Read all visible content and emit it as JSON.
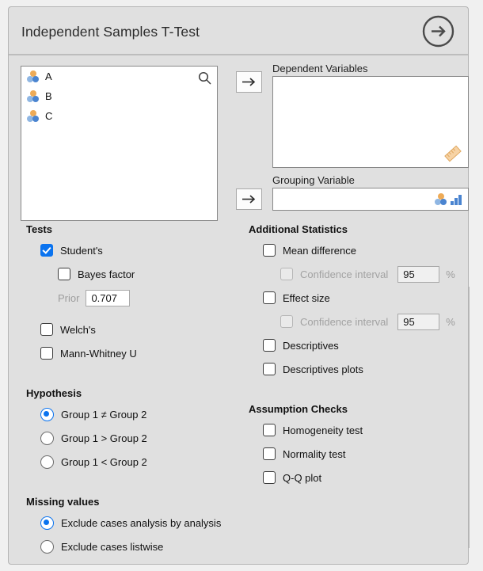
{
  "header": {
    "title": "Independent Samples T-Test",
    "next_icon": "arrow-right-circle-icon"
  },
  "variables": {
    "search_icon": "search-icon",
    "items": [
      {
        "name": "A",
        "icon": "nominal-icon"
      },
      {
        "name": "B",
        "icon": "nominal-icon"
      },
      {
        "name": "C",
        "icon": "nominal-icon"
      }
    ]
  },
  "assign_buttons": {
    "dependent_arrow": "arrow-right-icon",
    "grouping_arrow": "arrow-right-icon"
  },
  "dependent_variables": {
    "label": "Dependent Variables",
    "value": "",
    "allowed_type_icon": "scale-ruler-icon"
  },
  "grouping_variable": {
    "label": "Grouping Variable",
    "value": "",
    "allowed_type_icons": [
      "nominal-icon",
      "ordinal-icon"
    ]
  },
  "tests": {
    "title": "Tests",
    "students": {
      "label": "Student's",
      "checked": true
    },
    "bayes_factor": {
      "label": "Bayes factor",
      "checked": false
    },
    "prior": {
      "label": "Prior",
      "value": "0.707",
      "enabled": false
    },
    "welchs": {
      "label": "Welch's",
      "checked": false
    },
    "mann_whitney": {
      "label": "Mann-Whitney U",
      "checked": false
    }
  },
  "hypothesis": {
    "title": "Hypothesis",
    "options": [
      {
        "label": "Group 1 ≠ Group 2",
        "selected": true
      },
      {
        "label": "Group 1 > Group 2",
        "selected": false
      },
      {
        "label": "Group 1 < Group 2",
        "selected": false
      }
    ]
  },
  "missing_values": {
    "title": "Missing values",
    "options": [
      {
        "label": "Exclude cases analysis by analysis",
        "selected": true
      },
      {
        "label": "Exclude cases listwise",
        "selected": false
      }
    ]
  },
  "additional_statistics": {
    "title": "Additional Statistics",
    "mean_difference": {
      "label": "Mean difference",
      "checked": false
    },
    "mean_difference_ci": {
      "label": "Confidence interval",
      "checked": false,
      "value": "95",
      "unit": "%",
      "enabled": false
    },
    "effect_size": {
      "label": "Effect size",
      "checked": false
    },
    "effect_size_ci": {
      "label": "Confidence interval",
      "checked": false,
      "value": "95",
      "unit": "%",
      "enabled": false
    },
    "descriptives": {
      "label": "Descriptives",
      "checked": false
    },
    "descriptives_plots": {
      "label": "Descriptives plots",
      "checked": false
    }
  },
  "assumption_checks": {
    "title": "Assumption Checks",
    "homogeneity": {
      "label": "Homogeneity test",
      "checked": false
    },
    "normality": {
      "label": "Normality test",
      "checked": false
    },
    "qq_plot": {
      "label": "Q-Q plot",
      "checked": false
    }
  },
  "colors": {
    "accent": "#0a73ef",
    "panel_bg": "#e0e0e0",
    "nominal_orange": "#eeab57",
    "nominal_blue_light": "#8fb6e3",
    "nominal_blue_dark": "#4a84d0",
    "ruler_tan": "#f3c894"
  }
}
